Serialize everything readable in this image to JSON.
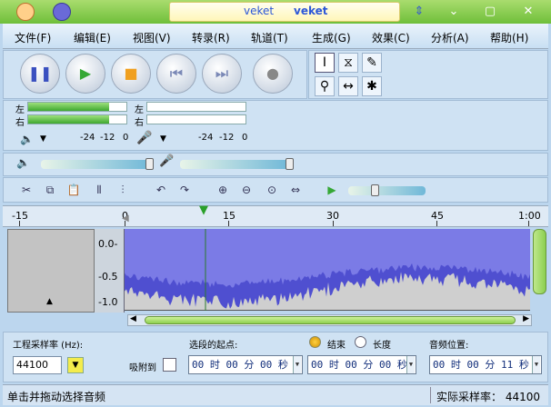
{
  "window": {
    "title_left": "veket",
    "title_right": "veket"
  },
  "menu": [
    {
      "label": "文件(F)"
    },
    {
      "label": "编辑(E)"
    },
    {
      "label": "视图(V)"
    },
    {
      "label": "转录(R)"
    },
    {
      "label": "轨道(T)"
    },
    {
      "label": "生成(G)"
    },
    {
      "label": "效果(C)"
    },
    {
      "label": "分析(A)"
    },
    {
      "label": "帮助(H)"
    }
  ],
  "meters": {
    "play_left_label": "左",
    "play_right_label": "右",
    "rec_left_label": "左",
    "rec_right_label": "右",
    "play_scale": [
      "-24",
      "-12",
      "0"
    ],
    "rec_scale": [
      "-24",
      "-12",
      "0"
    ],
    "play_level": 0.82,
    "rec_level": 0.0
  },
  "ruler": {
    "ticks": [
      "-15",
      "0",
      "15",
      "30",
      "45",
      "1:00"
    ]
  },
  "track": {
    "scale": [
      "0.0-",
      "-0.5",
      "-1.0"
    ]
  },
  "bottom": {
    "project_rate_label": "工程采样率 (Hz):",
    "project_rate_value": "44100",
    "snap_label": "吸附到",
    "selection_start_label": "选段的起点:",
    "end_label": "结束",
    "length_label": "长度",
    "audio_position_label": "音频位置:",
    "time_start": "00 时 00 分 00 秒",
    "time_end": "00 时 00 分 00 秒",
    "time_audio": "00 时 00 分 11 秒"
  },
  "status": {
    "left": "单击并拖动选择音频",
    "right": "实际采样率：  44100"
  },
  "colors": {
    "waveform": "#4f4fd0",
    "waveform_light": "#7b7be6",
    "accent_green": "#6fbf3a"
  }
}
